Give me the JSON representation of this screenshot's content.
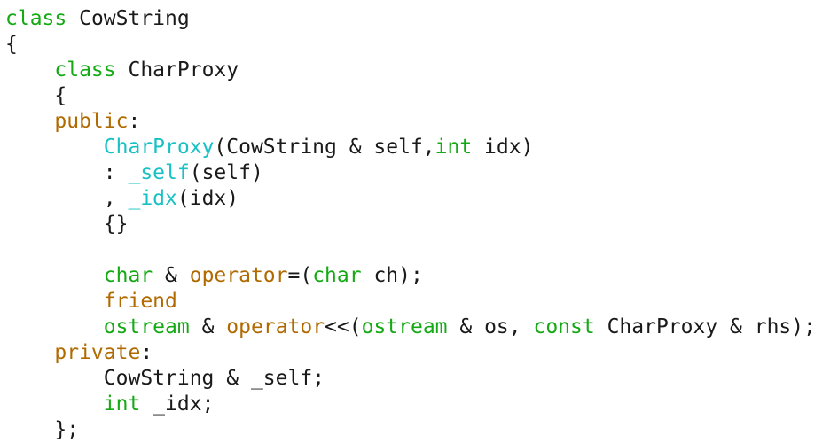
{
  "colors": {
    "background": "#ffffff",
    "default": "#1a1a1a",
    "keyword": "#15a915",
    "type": "#15a915",
    "access": "#b06a00",
    "operator": "#b06a00",
    "function": "#17c1c4"
  },
  "code": {
    "lines": [
      [
        {
          "t": "class",
          "c": "keyword"
        },
        {
          "t": " CowString",
          "c": "default"
        }
      ],
      [
        {
          "t": "{",
          "c": "default"
        }
      ],
      [
        {
          "t": "    ",
          "c": "default"
        },
        {
          "t": "class",
          "c": "keyword"
        },
        {
          "t": " CharProxy",
          "c": "default"
        }
      ],
      [
        {
          "t": "    {",
          "c": "default"
        }
      ],
      [
        {
          "t": "    ",
          "c": "default"
        },
        {
          "t": "public",
          "c": "access"
        },
        {
          "t": ":",
          "c": "default"
        }
      ],
      [
        {
          "t": "        ",
          "c": "default"
        },
        {
          "t": "CharProxy",
          "c": "function"
        },
        {
          "t": "(CowString & self,",
          "c": "default"
        },
        {
          "t": "int",
          "c": "type"
        },
        {
          "t": " idx)",
          "c": "default"
        }
      ],
      [
        {
          "t": "        : ",
          "c": "default"
        },
        {
          "t": "_self",
          "c": "function"
        },
        {
          "t": "(self)",
          "c": "default"
        }
      ],
      [
        {
          "t": "        , ",
          "c": "default"
        },
        {
          "t": "_idx",
          "c": "function"
        },
        {
          "t": "(idx)",
          "c": "default"
        }
      ],
      [
        {
          "t": "        {}",
          "c": "default"
        }
      ],
      [
        {
          "t": "",
          "c": "default"
        }
      ],
      [
        {
          "t": "        ",
          "c": "default"
        },
        {
          "t": "char",
          "c": "type"
        },
        {
          "t": " & ",
          "c": "default"
        },
        {
          "t": "operator",
          "c": "operator"
        },
        {
          "t": "=(",
          "c": "default"
        },
        {
          "t": "char",
          "c": "type"
        },
        {
          "t": " ch);",
          "c": "default"
        }
      ],
      [
        {
          "t": "        ",
          "c": "default"
        },
        {
          "t": "friend",
          "c": "access"
        }
      ],
      [
        {
          "t": "        ",
          "c": "default"
        },
        {
          "t": "ostream",
          "c": "type"
        },
        {
          "t": " & ",
          "c": "default"
        },
        {
          "t": "operator",
          "c": "operator"
        },
        {
          "t": "<<(",
          "c": "default"
        },
        {
          "t": "ostream",
          "c": "type"
        },
        {
          "t": " & os, ",
          "c": "default"
        },
        {
          "t": "const",
          "c": "keyword"
        },
        {
          "t": " CharProxy & rhs);",
          "c": "default"
        }
      ],
      [
        {
          "t": "    ",
          "c": "default"
        },
        {
          "t": "private",
          "c": "access"
        },
        {
          "t": ":",
          "c": "default"
        }
      ],
      [
        {
          "t": "        CowString & _self;",
          "c": "default"
        }
      ],
      [
        {
          "t": "        ",
          "c": "default"
        },
        {
          "t": "int",
          "c": "type"
        },
        {
          "t": " _idx;",
          "c": "default"
        }
      ],
      [
        {
          "t": "    };",
          "c": "default"
        }
      ]
    ]
  }
}
